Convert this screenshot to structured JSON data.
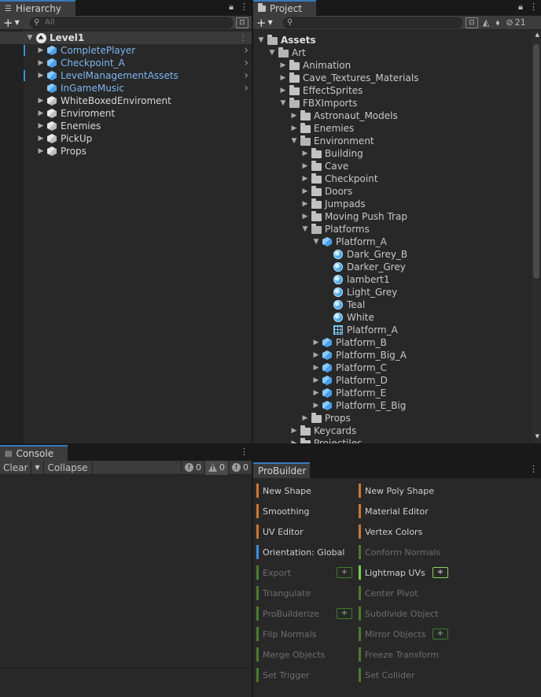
{
  "hierarchy": {
    "tab_label": "Hierarchy",
    "search_placeholder": "All",
    "scene": "Level1",
    "items": [
      {
        "label": "CompletePlayer",
        "color": "blue",
        "expandable": true,
        "marker": true,
        "chevron": true
      },
      {
        "label": "Checkpoint_A",
        "color": "blue",
        "expandable": true,
        "marker": false,
        "chevron": true
      },
      {
        "label": "LevelManagementAssets",
        "color": "blue",
        "expandable": true,
        "marker": true,
        "chevron": true
      },
      {
        "label": "InGameMusic",
        "color": "blue",
        "expandable": false,
        "marker": false,
        "chevron": true
      },
      {
        "label": "WhiteBoxedEnviroment",
        "color": "white",
        "expandable": true,
        "marker": false,
        "chevron": false
      },
      {
        "label": "Enviroment",
        "color": "white",
        "expandable": true,
        "marker": false,
        "chevron": false
      },
      {
        "label": "Enemies",
        "color": "white",
        "expandable": true,
        "marker": false,
        "chevron": false
      },
      {
        "label": "PickUp",
        "color": "white",
        "expandable": true,
        "marker": false,
        "chevron": false
      },
      {
        "label": "Props",
        "color": "white",
        "expandable": true,
        "marker": false,
        "chevron": false
      }
    ]
  },
  "project": {
    "tab_label": "Project",
    "hidden_count": "21",
    "tree": [
      {
        "label": "Assets",
        "depth": 0,
        "icon": "folder-open",
        "arrow": "open",
        "bold": true
      },
      {
        "label": "Art",
        "depth": 1,
        "icon": "folder-open",
        "arrow": "open"
      },
      {
        "label": "Animation",
        "depth": 2,
        "icon": "folder",
        "arrow": "closed"
      },
      {
        "label": "Cave_Textures_Materials",
        "depth": 2,
        "icon": "folder",
        "arrow": "closed"
      },
      {
        "label": "EffectSprites",
        "depth": 2,
        "icon": "folder",
        "arrow": "closed"
      },
      {
        "label": "FBXImports",
        "depth": 2,
        "icon": "folder-open",
        "arrow": "open"
      },
      {
        "label": "Astronaut_Models",
        "depth": 3,
        "icon": "folder",
        "arrow": "closed"
      },
      {
        "label": "Enemies",
        "depth": 3,
        "icon": "folder",
        "arrow": "closed"
      },
      {
        "label": "Environment",
        "depth": 3,
        "icon": "folder-open",
        "arrow": "open"
      },
      {
        "label": "Building",
        "depth": 4,
        "icon": "folder",
        "arrow": "closed"
      },
      {
        "label": "Cave",
        "depth": 4,
        "icon": "folder",
        "arrow": "closed"
      },
      {
        "label": "Checkpoint",
        "depth": 4,
        "icon": "folder",
        "arrow": "closed"
      },
      {
        "label": "Doors",
        "depth": 4,
        "icon": "folder",
        "arrow": "closed"
      },
      {
        "label": "Jumpads",
        "depth": 4,
        "icon": "folder",
        "arrow": "closed"
      },
      {
        "label": "Moving Push Trap",
        "depth": 4,
        "icon": "folder",
        "arrow": "closed"
      },
      {
        "label": "Platforms",
        "depth": 4,
        "icon": "folder-open",
        "arrow": "open"
      },
      {
        "label": "Platform_A",
        "depth": 5,
        "icon": "cube",
        "arrow": "open"
      },
      {
        "label": "Dark_Grey_B",
        "depth": 6,
        "icon": "material",
        "arrow": "none"
      },
      {
        "label": "Darker_Grey",
        "depth": 6,
        "icon": "material",
        "arrow": "none"
      },
      {
        "label": "lambert1",
        "depth": 6,
        "icon": "material",
        "arrow": "none"
      },
      {
        "label": "Light_Grey",
        "depth": 6,
        "icon": "material",
        "arrow": "none"
      },
      {
        "label": "Teal",
        "depth": 6,
        "icon": "material",
        "arrow": "none"
      },
      {
        "label": "White",
        "depth": 6,
        "icon": "material",
        "arrow": "none"
      },
      {
        "label": "Platform_A",
        "depth": 6,
        "icon": "mesh",
        "arrow": "none"
      },
      {
        "label": "Platform_B",
        "depth": 5,
        "icon": "cube",
        "arrow": "closed"
      },
      {
        "label": "Platform_Big_A",
        "depth": 5,
        "icon": "cube",
        "arrow": "closed"
      },
      {
        "label": "Platform_C",
        "depth": 5,
        "icon": "cube",
        "arrow": "closed"
      },
      {
        "label": "Platform_D",
        "depth": 5,
        "icon": "cube",
        "arrow": "closed"
      },
      {
        "label": "Platform_E",
        "depth": 5,
        "icon": "cube",
        "arrow": "closed"
      },
      {
        "label": "Platform_E_Big",
        "depth": 5,
        "icon": "cube",
        "arrow": "closed"
      },
      {
        "label": "Props",
        "depth": 4,
        "icon": "folder",
        "arrow": "closed"
      },
      {
        "label": "Keycards",
        "depth": 3,
        "icon": "folder",
        "arrow": "closed"
      },
      {
        "label": "Projectiles",
        "depth": 3,
        "icon": "folder",
        "arrow": "closed"
      }
    ]
  },
  "console": {
    "tab_label": "Console",
    "clear_label": "Clear",
    "collapse_label": "Collapse",
    "log_count": "0",
    "warning_count": "0",
    "error_count": "0"
  },
  "probuilder": {
    "tab_label": "ProBuilder",
    "left": [
      {
        "label": "New Shape",
        "color": "#c87836",
        "enabled": true,
        "plus": false
      },
      {
        "label": "Smoothing",
        "color": "#c87836",
        "enabled": true,
        "plus": false
      },
      {
        "label": "UV Editor",
        "color": "#c87836",
        "enabled": true,
        "plus": false
      },
      {
        "label": "Orientation: Global",
        "color": "#3b8fd9",
        "enabled": true,
        "plus": false
      },
      {
        "label": "Export",
        "color": "#4c7a2e",
        "enabled": false,
        "plus": true
      },
      {
        "label": "Triangulate",
        "color": "#4c7a2e",
        "enabled": false,
        "plus": false
      },
      {
        "label": "ProBuilderize",
        "color": "#4c7a2e",
        "enabled": false,
        "plus": true
      },
      {
        "label": "Flip Normals",
        "color": "#4c7a2e",
        "enabled": false,
        "plus": false
      },
      {
        "label": "Merge Objects",
        "color": "#4c7a2e",
        "enabled": false,
        "plus": false
      },
      {
        "label": "Set Trigger",
        "color": "#4c7a2e",
        "enabled": false,
        "plus": false
      }
    ],
    "right": [
      {
        "label": "New Poly Shape",
        "color": "#c87836",
        "enabled": true,
        "plus": false
      },
      {
        "label": "Material Editor",
        "color": "#c87836",
        "enabled": true,
        "plus": false
      },
      {
        "label": "Vertex Colors",
        "color": "#c87836",
        "enabled": true,
        "plus": false
      },
      {
        "label": "Conform Normals",
        "color": "#4c7a2e",
        "enabled": false,
        "plus": false
      },
      {
        "label": "Lightmap UVs",
        "color": "#7ccf4a",
        "enabled": true,
        "plus": true
      },
      {
        "label": "Center Pivot",
        "color": "#4c7a2e",
        "enabled": false,
        "plus": false
      },
      {
        "label": "Subdivide Object",
        "color": "#4c7a2e",
        "enabled": false,
        "plus": false
      },
      {
        "label": "Mirror Objects",
        "color": "#4c7a2e",
        "enabled": false,
        "plus": true
      },
      {
        "label": "Freeze Transform",
        "color": "#4c7a2e",
        "enabled": false,
        "plus": false
      },
      {
        "label": "Set Collider",
        "color": "#4c7a2e",
        "enabled": false,
        "plus": false
      }
    ]
  }
}
